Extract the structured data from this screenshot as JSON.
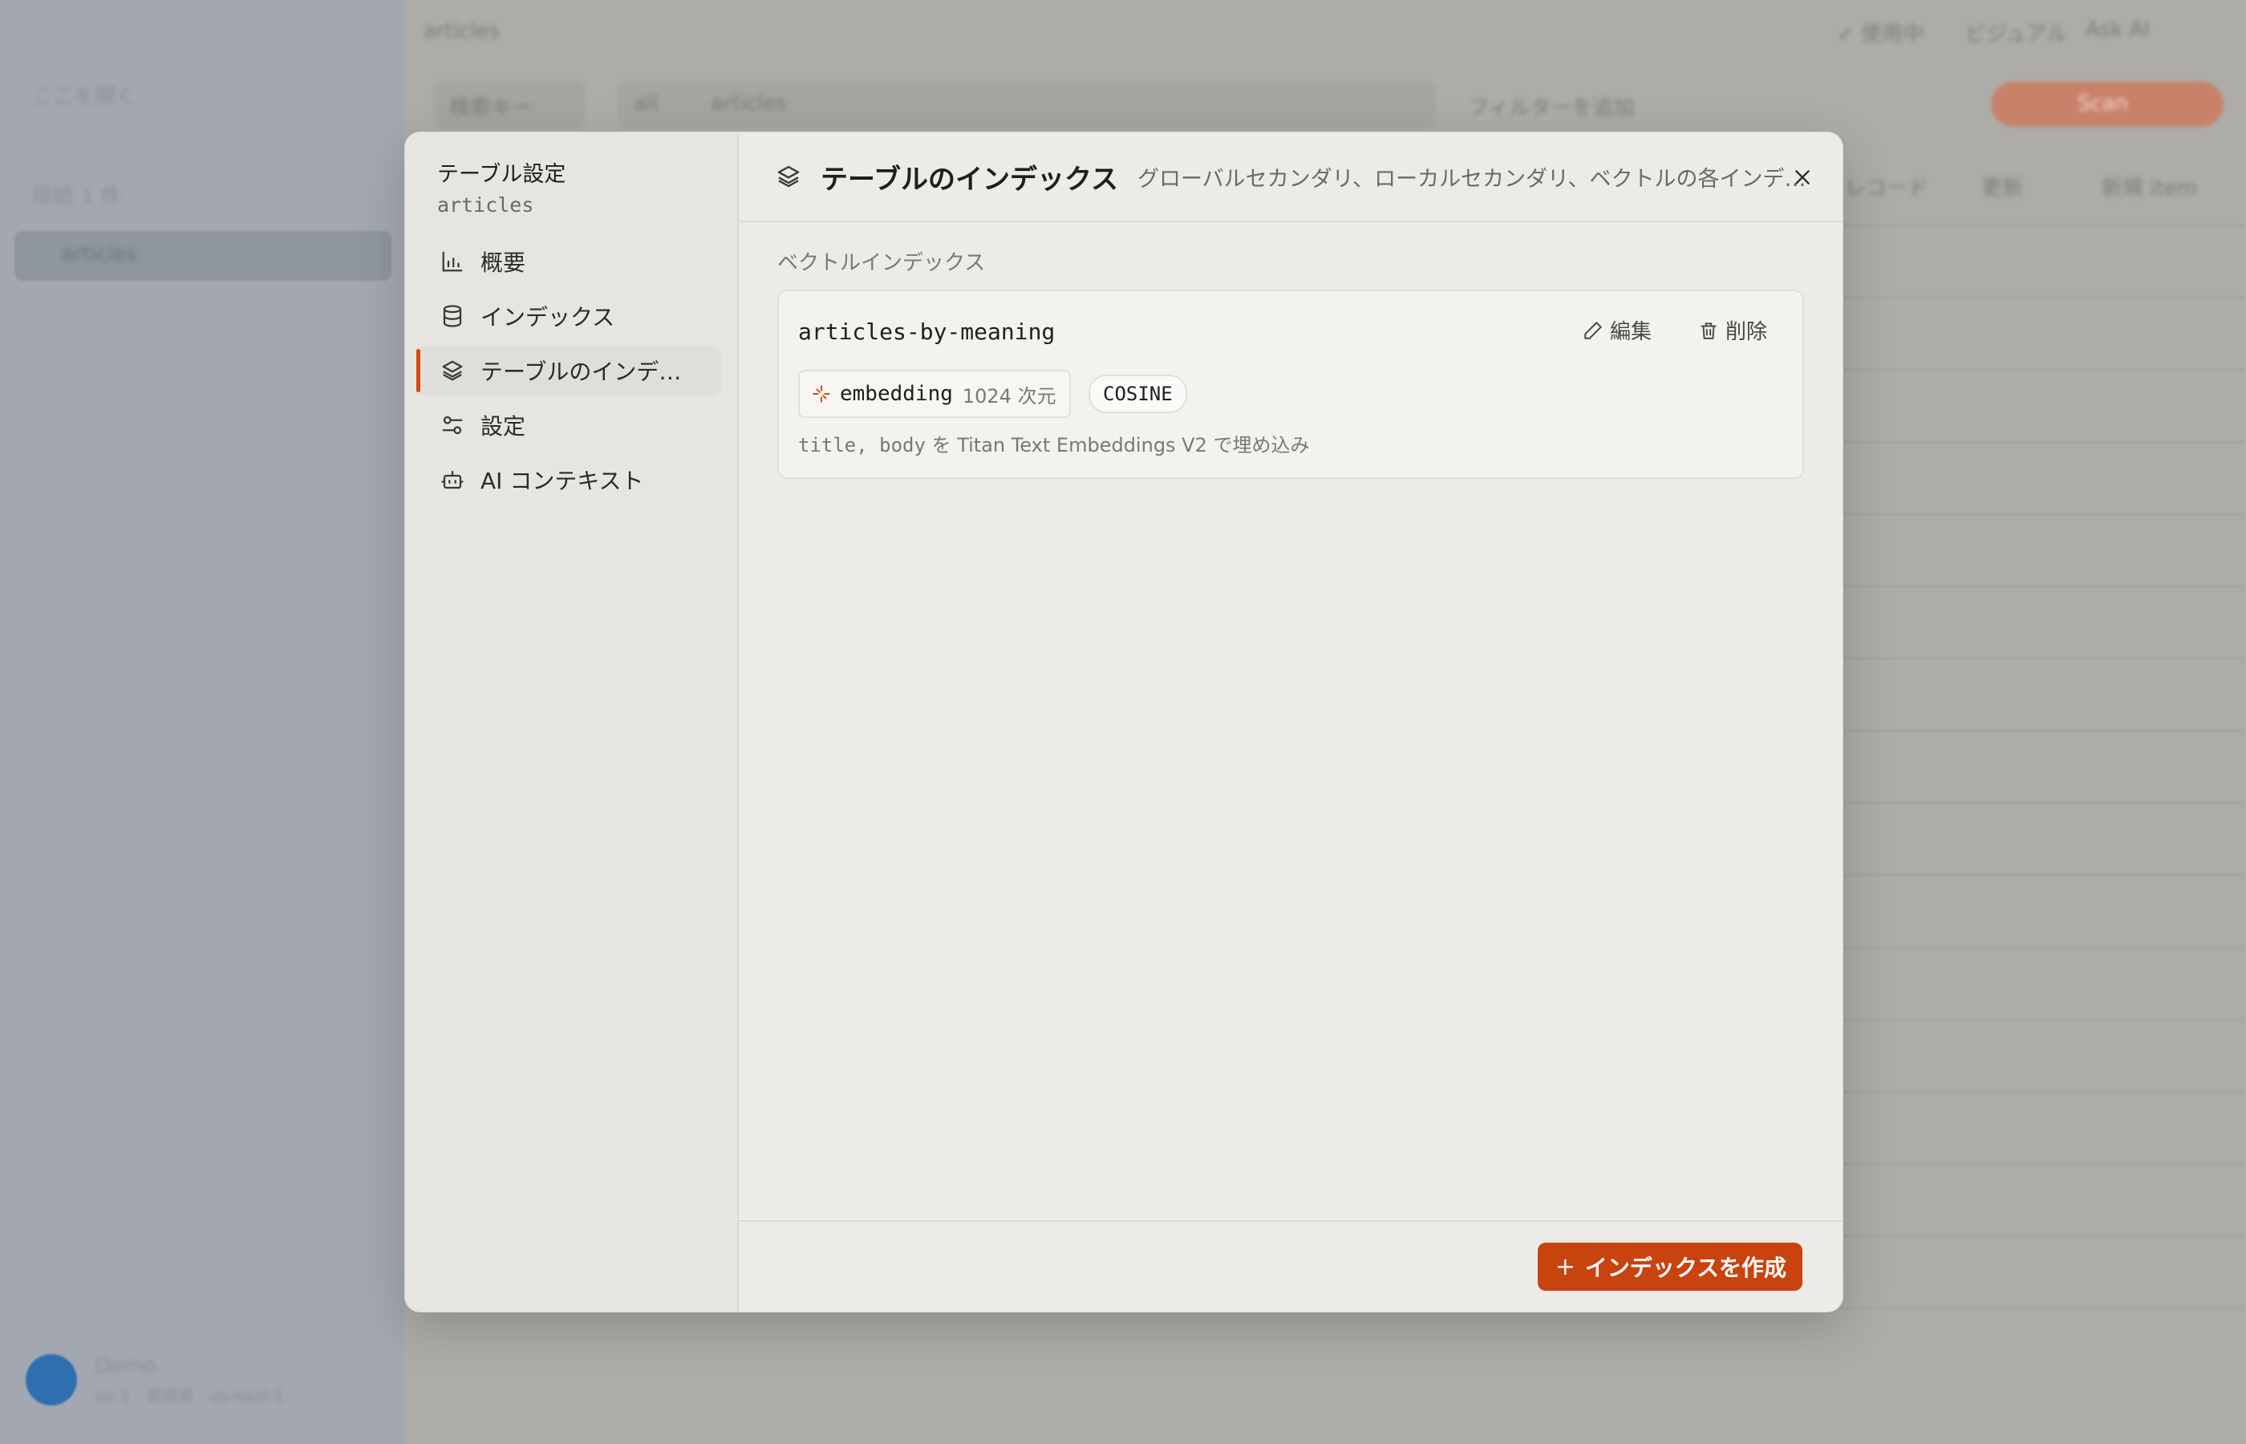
{
  "background": {
    "sidebar": {
      "back_link": "ここを開く",
      "group_label": "接続 1 件",
      "active_table": "articles",
      "user_name": "Demo",
      "user_sub": "ap-1 · 管理者 · us-east-1"
    },
    "main": {
      "table_title": "articles",
      "toolbar_items": [
        "✓ 使用中",
        "ビジュアル",
        "Ask AI"
      ],
      "query_mode": "検索キー",
      "query_scope": "all",
      "query_value": "articles",
      "filter_label": "フィルターを追加",
      "run_button": "Scan",
      "row_actions": [
        "レコード",
        "更新",
        "新規 item"
      ]
    }
  },
  "modal": {
    "sidebar": {
      "title": "テーブル設定",
      "subtitle": "articles",
      "items": [
        {
          "label": "概要",
          "icon": "bar-chart-icon"
        },
        {
          "label": "インデックス",
          "icon": "database-icon"
        },
        {
          "label": "テーブルのインデックス",
          "icon": "layers-icon",
          "active": true
        },
        {
          "label": "設定",
          "icon": "sliders-icon"
        },
        {
          "label": "AI コンテキスト",
          "icon": "bot-icon"
        }
      ]
    },
    "header": {
      "title": "テーブルのインデックス",
      "description": "グローバルセカンダリ、ローカルセカンダリ、ベクトルの各インデックス"
    },
    "section_label": "ベクトルインデックス",
    "vector_index": {
      "name": "articles-by-meaning",
      "edit_label": "編集",
      "delete_label": "削除",
      "field": "embedding",
      "dimensions": "1024 次元",
      "metric": "COSINE",
      "source_fields": "title, body",
      "source_text": " を Titan Text Embeddings V2 で埋め込み"
    },
    "footer": {
      "create_label": "インデックスを作成"
    }
  },
  "colors": {
    "accent": "#c9430f",
    "active_indicator": "#d24a16"
  }
}
